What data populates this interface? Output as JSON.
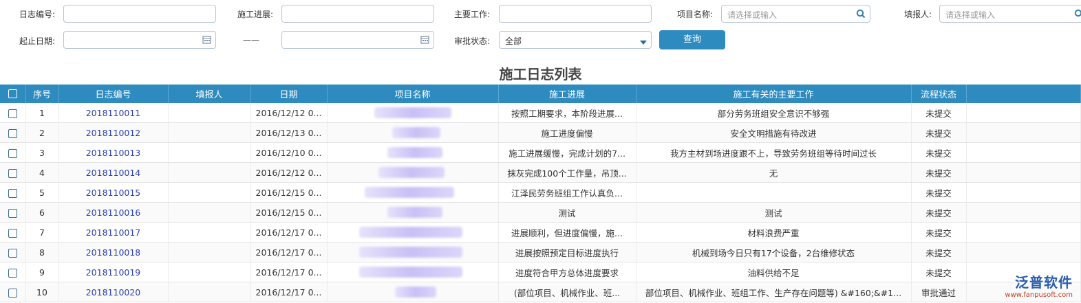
{
  "filters": {
    "log_no_label": "日志编号:",
    "progress_label": "施工进展:",
    "main_work_label": "主要工作:",
    "project_label": "项目名称:",
    "project_placeholder": "请选择或输入",
    "reporter_label": "填报人:",
    "reporter_placeholder": "请选择或输入",
    "date_label": "起止日期:",
    "date_sep": "——",
    "approval_label": "审批状态:",
    "approval_value": "全部",
    "query_label": "查询"
  },
  "table": {
    "title": "施工日志列表",
    "headers": [
      "序号",
      "日志编号",
      "填报人",
      "日期",
      "项目名称",
      "施工进展",
      "施工有关的主要工作",
      "流程状态"
    ],
    "rows": [
      {
        "no": "1",
        "id": "2018110011",
        "reporter": "",
        "date": "2016/12/12 0...",
        "progress": "按照工期要求，本阶段进展...",
        "work": "部分劳务班组安全意识不够强",
        "status": "未提交"
      },
      {
        "no": "2",
        "id": "2018110012",
        "reporter": "",
        "date": "2016/12/13 0...",
        "progress": "施工进度偏慢",
        "work": "安全文明措施有待改进",
        "status": "未提交"
      },
      {
        "no": "3",
        "id": "2018110013",
        "reporter": "",
        "date": "2016/12/10 0...",
        "progress": "施工进展缓慢，完成计划的7...",
        "work": "我方主材到场进度跟不上，导致劳务班组等待时间过长",
        "status": "未提交"
      },
      {
        "no": "4",
        "id": "2018110014",
        "reporter": "",
        "date": "2016/12/12 0...",
        "progress": "抹灰完成100个工作量，吊顶...",
        "work": "无",
        "status": "未提交"
      },
      {
        "no": "5",
        "id": "2018110015",
        "reporter": "",
        "date": "2016/12/15 0...",
        "progress": "江泽民劳务班组工作认真负...",
        "work": "",
        "status": "未提交"
      },
      {
        "no": "6",
        "id": "2018110016",
        "reporter": "",
        "date": "2016/12/15 0...",
        "progress": "测试",
        "work": "测试",
        "status": "未提交"
      },
      {
        "no": "7",
        "id": "2018110017",
        "reporter": "",
        "date": "2016/12/17 0...",
        "progress": "进展顺利，但进度偏慢，施...",
        "work": "材料浪费严重",
        "status": "未提交"
      },
      {
        "no": "8",
        "id": "2018110018",
        "reporter": "",
        "date": "2016/12/17 0...",
        "progress": "进展按照预定目标进度执行",
        "work": "机械到场今日只有17个设备，2台维修状态",
        "status": "未提交"
      },
      {
        "no": "9",
        "id": "2018110019",
        "reporter": "",
        "date": "2016/12/17 0...",
        "progress": "进度符合甲方总体进度要求",
        "work": "油料供给不足",
        "status": "未提交"
      },
      {
        "no": "10",
        "id": "2018110020",
        "reporter": "",
        "date": "2016/12/17 0...",
        "progress": "(部位项目、机械作业、班...",
        "work": "部位项目、机械作业、班组工作、生产存在问题等) &#160;&#1...",
        "status": "审批通过"
      }
    ]
  },
  "logo": {
    "text": "泛普软件",
    "url": "www.fanpusoft.com"
  }
}
